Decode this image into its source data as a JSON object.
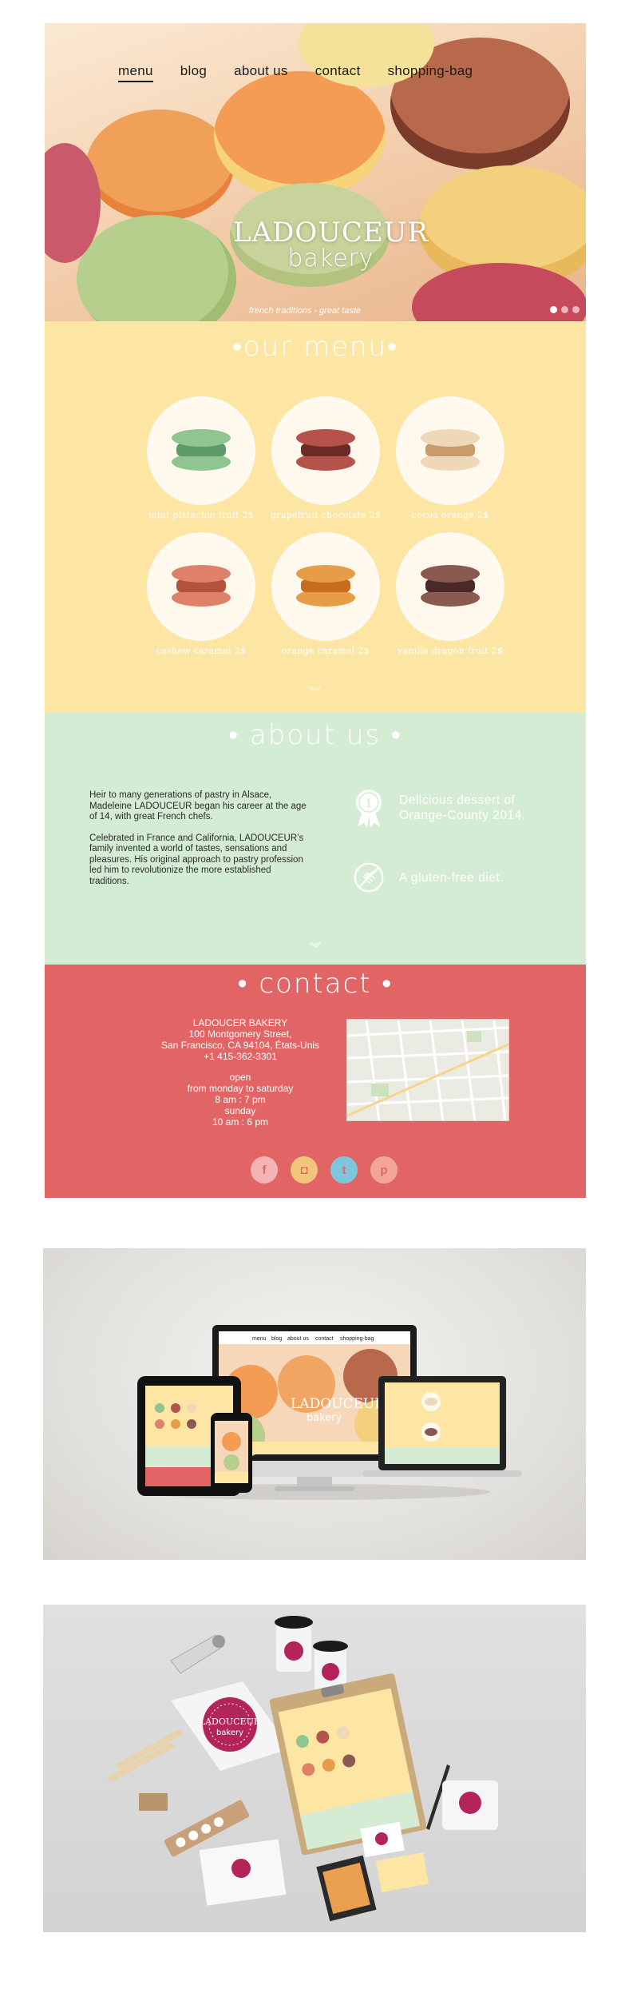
{
  "nav": {
    "items": [
      "menu",
      "blog",
      "about us",
      "contact",
      "shopping-bag"
    ],
    "active": "menu"
  },
  "hero": {
    "brand_line1": "LADOUCEUR",
    "brand_line2": "bakery",
    "tagline": "french traditions - great taste",
    "slides_total": 3,
    "slide_active": 1
  },
  "menu_section": {
    "title": "•our menu•",
    "items": [
      {
        "label": "mint pistachio fruit 2$",
        "colors": {
          "shell": "#8fc58f",
          "cream": "#5e9b6b"
        }
      },
      {
        "label": "grapefruit chocolate 2$",
        "colors": {
          "shell": "#b5524a",
          "cream": "#6b2a25"
        }
      },
      {
        "label": "cocoa orange 2$",
        "colors": {
          "shell": "#efd8b8",
          "cream": "#c99a6a"
        }
      },
      {
        "label": "cashew caramel 2$",
        "colors": {
          "shell": "#df8069",
          "cream": "#b4523c"
        }
      },
      {
        "label": "orange caramel 2$",
        "colors": {
          "shell": "#e79d48",
          "cream": "#c66b1f"
        }
      },
      {
        "label": "vanilla dragon fruit 2$",
        "colors": {
          "shell": "#8a5a50",
          "cream": "#4a2a28"
        }
      }
    ]
  },
  "about_section": {
    "title": "• about us •",
    "paragraph1": "Heir to many generations of pastry in Alsace, Madeleine LADOUCEUR began his career at the age of 14, with great French chefs.",
    "paragraph2": "Celebrated in France and California, LADOUCEUR’s family invented a world of tastes, sensations and pleasures. His original approach to pastry profession led him to revolutionize the more established traditions.",
    "awards": [
      {
        "icon": "medal-icon",
        "text": "Delicious dessert of Orange-County 2014."
      },
      {
        "icon": "no-gluten-icon",
        "text": "A gluten-free diet."
      }
    ]
  },
  "contact_section": {
    "title": "•  contact  •",
    "company": "LADOUCER BAKERY",
    "street": "100 Montgomery Street,",
    "city": "San Francisco, CA 94104, États-Unis",
    "phone": "+1 415-362-3301",
    "hours_title": "open",
    "weekday_range": "from monday to saturday",
    "weekday_hours": "8 am : 7 pm",
    "sunday_label": "sunday",
    "sunday_hours": "10 am : 6 pm",
    "socials": [
      {
        "icon": "facebook-icon",
        "glyph": "f",
        "color": "#f6b3b3"
      },
      {
        "icon": "instagram-icon",
        "glyph": "◘",
        "color": "#f2c57c"
      },
      {
        "icon": "twitter-icon",
        "glyph": "t",
        "color": "#7fc6dd"
      },
      {
        "icon": "pinterest-icon",
        "glyph": "p",
        "color": "#f4a59a"
      }
    ]
  },
  "mockups": {
    "devices_nav": [
      "menu",
      "blog",
      "about us",
      "contact",
      "shopping-bag"
    ],
    "devices_brand1": "LADOUCEUR",
    "devices_brand2": "bakery",
    "stationery_logo1": "LADOUCEUR",
    "stationery_logo2": "bakery"
  },
  "colors": {
    "menu_bg": "#fde5a3",
    "about_bg": "#d4ecd4",
    "contact_bg": "#e26565",
    "brand_magenta": "#b3245a"
  }
}
